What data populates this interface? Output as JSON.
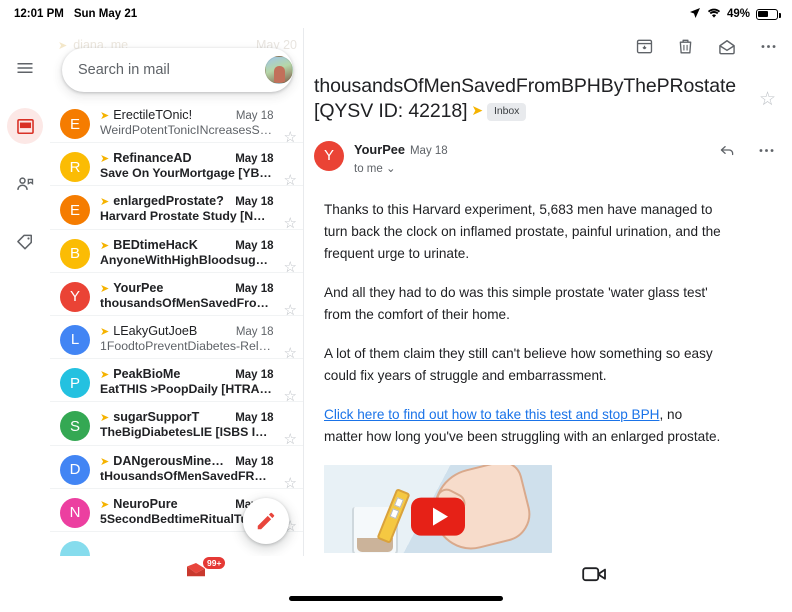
{
  "status_bar": {
    "time": "12:01 PM",
    "date": "Sun May 21",
    "location_icon": "location-arrow-icon",
    "wifi_icon": "wifi-icon",
    "battery_percent": "49%",
    "battery_icon": "battery-icon"
  },
  "rail": {
    "items": [
      {
        "name": "menu-icon",
        "label": "Menu",
        "active": false
      },
      {
        "name": "inbox-icon",
        "label": "Mail",
        "active": true
      },
      {
        "name": "meet-icon",
        "label": "Meet",
        "active": false
      },
      {
        "name": "labels-icon",
        "label": "Labels",
        "active": false
      }
    ]
  },
  "search": {
    "placeholder": "Search in mail",
    "value": "",
    "avatar_name": "account-avatar"
  },
  "ghost_row": {
    "sender": "diana, me",
    "date": "May 20"
  },
  "mail_list": {
    "compose_label": "Compose",
    "rows": [
      {
        "initial": "E",
        "color": "#f57c00",
        "sender": "ErectileTOnic!",
        "subject": "WeirdPotentTonicINcreasesST…",
        "date": "May 18",
        "unread": false,
        "important": true
      },
      {
        "initial": "R",
        "color": "#fbbc04",
        "sender": "RefinanceAD",
        "subject": "Save On YourMortgage [YB…",
        "date": "May 18",
        "unread": true,
        "important": true
      },
      {
        "initial": "E",
        "color": "#f57c00",
        "sender": "enlargedProstate?",
        "subject": "Harvard Prostate Study [N…",
        "date": "May 18",
        "unread": true,
        "important": true
      },
      {
        "initial": "B",
        "color": "#fbbc04",
        "sender": "BEDtimeHacK",
        "subject": "AnyoneWithHighBloodsug…",
        "date": "May 18",
        "unread": true,
        "important": true
      },
      {
        "initial": "Y",
        "color": "#ea4335",
        "sender": "YourPee",
        "subject": "thousandsOfMenSavedFro…",
        "date": "May 18",
        "unread": true,
        "important": true
      },
      {
        "initial": "L",
        "color": "#4285f4",
        "sender": "LEakyGutJoeB",
        "subject": "1FoodtoPreventDiabetes-Rela…",
        "date": "May 18",
        "unread": false,
        "important": true
      },
      {
        "initial": "P",
        "color": "#24c1e0",
        "sender": "PeakBioMe",
        "subject": "EatTHIS >PoopDaily  [HTRA…",
        "date": "May 18",
        "unread": true,
        "important": true
      },
      {
        "initial": "S",
        "color": "#34a853",
        "sender": "sugarSupporT",
        "subject": "TheBigDiabetesLIE [ISBS ID…",
        "date": "May 18",
        "unread": true,
        "important": true
      },
      {
        "initial": "D",
        "color": "#4285f4",
        "sender": "DANgerousMineraL!",
        "subject": "tHousandsOfMenSavedFR…",
        "date": "May 18",
        "unread": true,
        "important": true
      },
      {
        "initial": "N",
        "color": "#ec3fa0",
        "sender": "NeuroPure",
        "subject": "5SecondBedtimeRitualTu…",
        "date": "May 18",
        "unread": true,
        "important": true
      }
    ]
  },
  "reading_pane": {
    "toolbar": [
      {
        "name": "archive-icon",
        "label": "Archive"
      },
      {
        "name": "delete-icon",
        "label": "Delete"
      },
      {
        "name": "mark-unread-icon",
        "label": "Mark as unread"
      },
      {
        "name": "more-options-icon",
        "label": "More options"
      }
    ],
    "subject": "thousandsOfMenSavedFromBPHByThePRostate  [QYSV ID: 42218]",
    "label_chip": "Inbox",
    "star_label": "Star",
    "message": {
      "avatar_initial": "Y",
      "avatar_color": "#ea4335",
      "sender": "YourPee",
      "date": "May 18",
      "recipient": "to me",
      "reply_label": "Reply",
      "more_label": "More",
      "paragraphs": [
        "Thanks to this Harvard experiment, 5,683 men have managed to turn back the clock on inflamed prostate, painful urination, and the frequent urge to urinate.",
        "And all they had to do was this simple prostate 'water glass test' from the comfort of their home.",
        "A lot of them claim they still can't believe how something so easy could fix years of struggle and embarrassment."
      ],
      "link_text": "Click here to find out how to take this test and stop BPH",
      "link_tail": ", no matter how long you've been struggling with an enlarged prostate.",
      "video_alt": "hand dipping test strip into water glass",
      "play_label": "Play video"
    }
  },
  "bottom_bar": {
    "mail_icon": "mail-dock-icon",
    "mail_badge": "99+",
    "video_icon": "video-camera-icon",
    "home_indicator": "home-indicator"
  }
}
